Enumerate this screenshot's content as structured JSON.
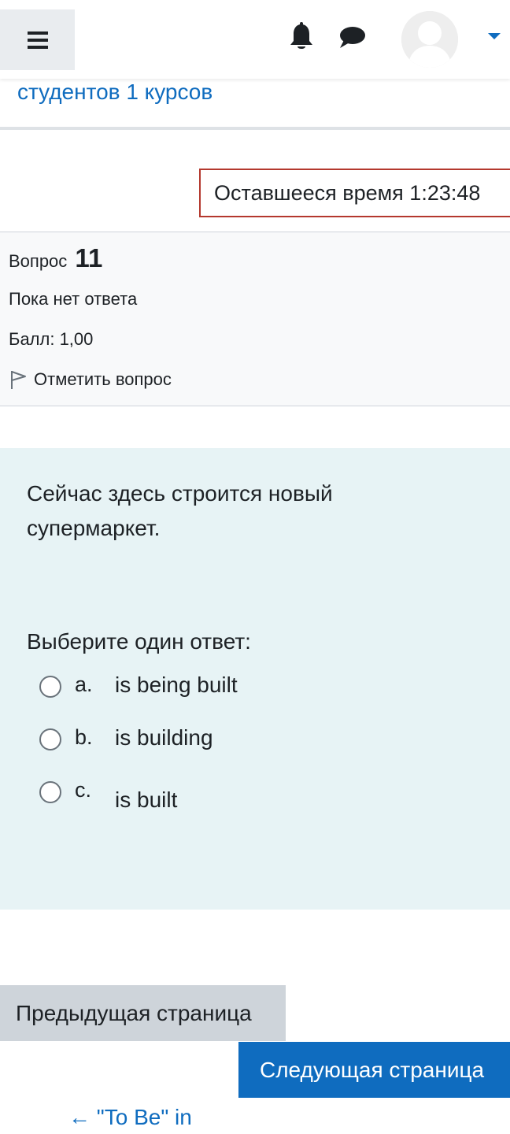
{
  "navbar": {
    "menu_icon": "hamburger-menu-icon",
    "notifications_icon": "bell-icon",
    "messages_icon": "chat-bubble-icon",
    "user_menu_icon": "caret-down-icon",
    "accent_color": "#0f6cbf"
  },
  "course": {
    "title": "студентов 1 курсов"
  },
  "timer": {
    "label": "Оставшееся время 1:23:48",
    "border_color": "#b4382e"
  },
  "question_info": {
    "label": "Вопрос",
    "number": "11",
    "state": "Пока нет ответа",
    "grade": "Балл: 1,00",
    "flag_label": "Отметить вопрос",
    "flag_icon": "flag-icon"
  },
  "question": {
    "text": "Сейчас здесь строится новый супермаркет.",
    "prompt": "Выберите один ответ:",
    "options": [
      {
        "letter": "a.",
        "text": "is being built",
        "selected": false
      },
      {
        "letter": "b.",
        "text": "is building",
        "selected": false
      },
      {
        "letter": "c.",
        "text": "is built",
        "selected": false
      }
    ]
  },
  "navigation": {
    "prev_label": "Предыдущая страница",
    "next_label": "Следующая страница",
    "back_link": "← \"To Be\" in"
  }
}
